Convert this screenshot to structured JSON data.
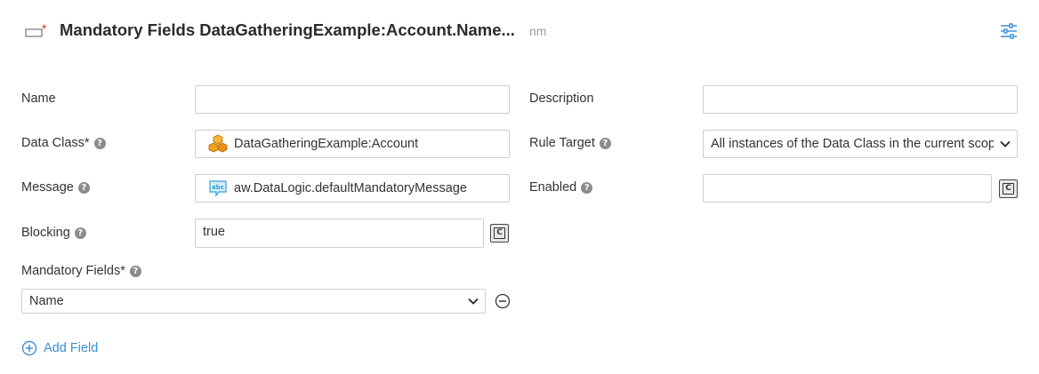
{
  "header": {
    "title": "Mandatory Fields DataGatheringExample:Account.Name...",
    "subtitle": "nm",
    "icons": {
      "rule": "mandatory-rule-icon",
      "settings": "sliders-icon"
    }
  },
  "form": {
    "name": {
      "label": "Name",
      "value": ""
    },
    "description": {
      "label": "Description",
      "value": ""
    },
    "data_class": {
      "label": "Data Class*",
      "value": "DataGatheringExample:Account",
      "icon": "data-class-cubes-icon"
    },
    "rule_target": {
      "label": "Rule Target",
      "value": "All instances of the Data Class in the current scope"
    },
    "message": {
      "label": "Message",
      "value": "aw.DataLogic.defaultMandatoryMessage",
      "icon": "abc-message-icon"
    },
    "enabled": {
      "label": "Enabled",
      "value": ""
    },
    "blocking": {
      "label": "Blocking",
      "value": "true"
    },
    "mandatory_fields": {
      "label": "Mandatory Fields*",
      "items": [
        {
          "value": "Name"
        }
      ]
    },
    "add_field_label": "Add Field",
    "help_glyph": "?",
    "expression_glyph": "C"
  },
  "colors": {
    "accent": "#3d8fd6",
    "required_star": "#d9342b",
    "class_icon": "#f0a020"
  }
}
